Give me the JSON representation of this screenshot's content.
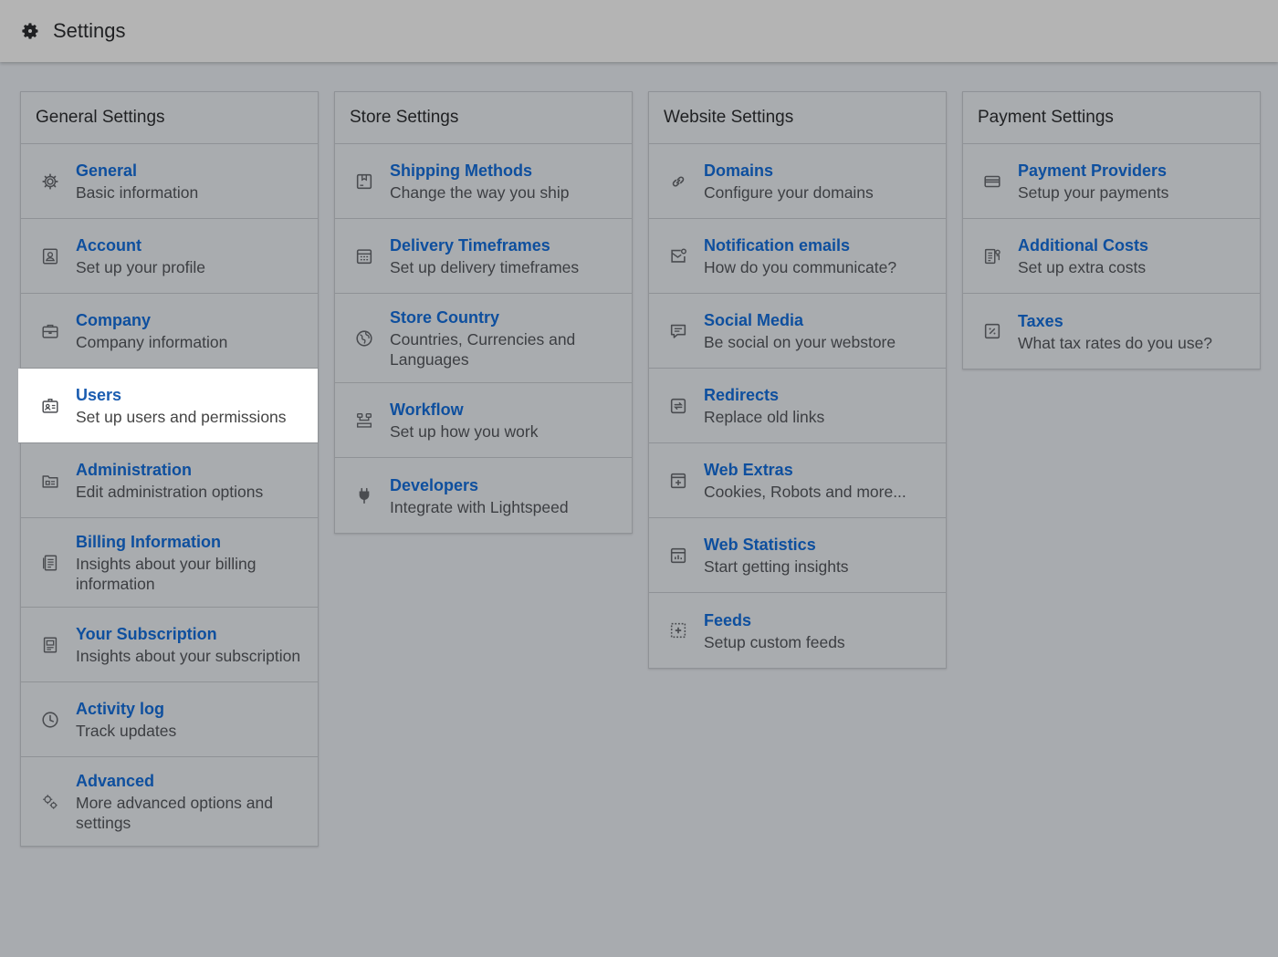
{
  "header": {
    "title": "Settings",
    "icon": "gear-icon"
  },
  "columns": [
    {
      "title": "General Settings",
      "items": [
        {
          "label": "General",
          "desc": "Basic information",
          "icon": "gear-icon"
        },
        {
          "label": "Account",
          "desc": "Set up your profile",
          "icon": "profile-card-icon"
        },
        {
          "label": "Company",
          "desc": "Company information",
          "icon": "briefcase-icon"
        },
        {
          "label": "Users",
          "desc": "Set up users and permissions",
          "icon": "users-badge-icon",
          "active": true
        },
        {
          "label": "Administration",
          "desc": "Edit administration options",
          "icon": "folder-icon"
        },
        {
          "label": "Billing Information",
          "desc": "Insights about your billing information",
          "icon": "invoice-icon"
        },
        {
          "label": "Your Subscription",
          "desc": "Insights about your subscription",
          "icon": "subscription-icon"
        },
        {
          "label": "Activity log",
          "desc": "Track updates",
          "icon": "clock-icon"
        },
        {
          "label": "Advanced",
          "desc": "More advanced options and settings",
          "icon": "gears-icon"
        }
      ]
    },
    {
      "title": "Store Settings",
      "items": [
        {
          "label": "Shipping Methods",
          "desc": "Change the way you ship",
          "icon": "box-icon"
        },
        {
          "label": "Delivery Timeframes",
          "desc": "Set up delivery timeframes",
          "icon": "calendar-icon"
        },
        {
          "label": "Store Country",
          "desc": "Countries, Currencies and Languages",
          "icon": "globe-icon"
        },
        {
          "label": "Workflow",
          "desc": "Set up how you work",
          "icon": "workflow-icon"
        },
        {
          "label": "Developers",
          "desc": "Integrate with Lightspeed",
          "icon": "plug-icon"
        }
      ]
    },
    {
      "title": "Website Settings",
      "items": [
        {
          "label": "Domains",
          "desc": "Configure your domains",
          "icon": "link-icon"
        },
        {
          "label": "Notification emails",
          "desc": "How do you communicate?",
          "icon": "mail-icon"
        },
        {
          "label": "Social Media",
          "desc": "Be social on your webstore",
          "icon": "chat-icon"
        },
        {
          "label": "Redirects",
          "desc": "Replace old links",
          "icon": "redirect-icon"
        },
        {
          "label": "Web Extras",
          "desc": "Cookies, Robots and more...",
          "icon": "plus-box-icon"
        },
        {
          "label": "Web Statistics",
          "desc": "Start getting insights",
          "icon": "stats-icon"
        },
        {
          "label": "Feeds",
          "desc": "Setup custom feeds",
          "icon": "feeds-icon"
        }
      ]
    },
    {
      "title": "Payment Settings",
      "items": [
        {
          "label": "Payment Providers",
          "desc": "Setup your payments",
          "icon": "credit-card-icon"
        },
        {
          "label": "Additional Costs",
          "desc": "Set up extra costs",
          "icon": "costs-icon"
        },
        {
          "label": "Taxes",
          "desc": "What tax rates do you use?",
          "icon": "percent-icon"
        }
      ]
    }
  ]
}
